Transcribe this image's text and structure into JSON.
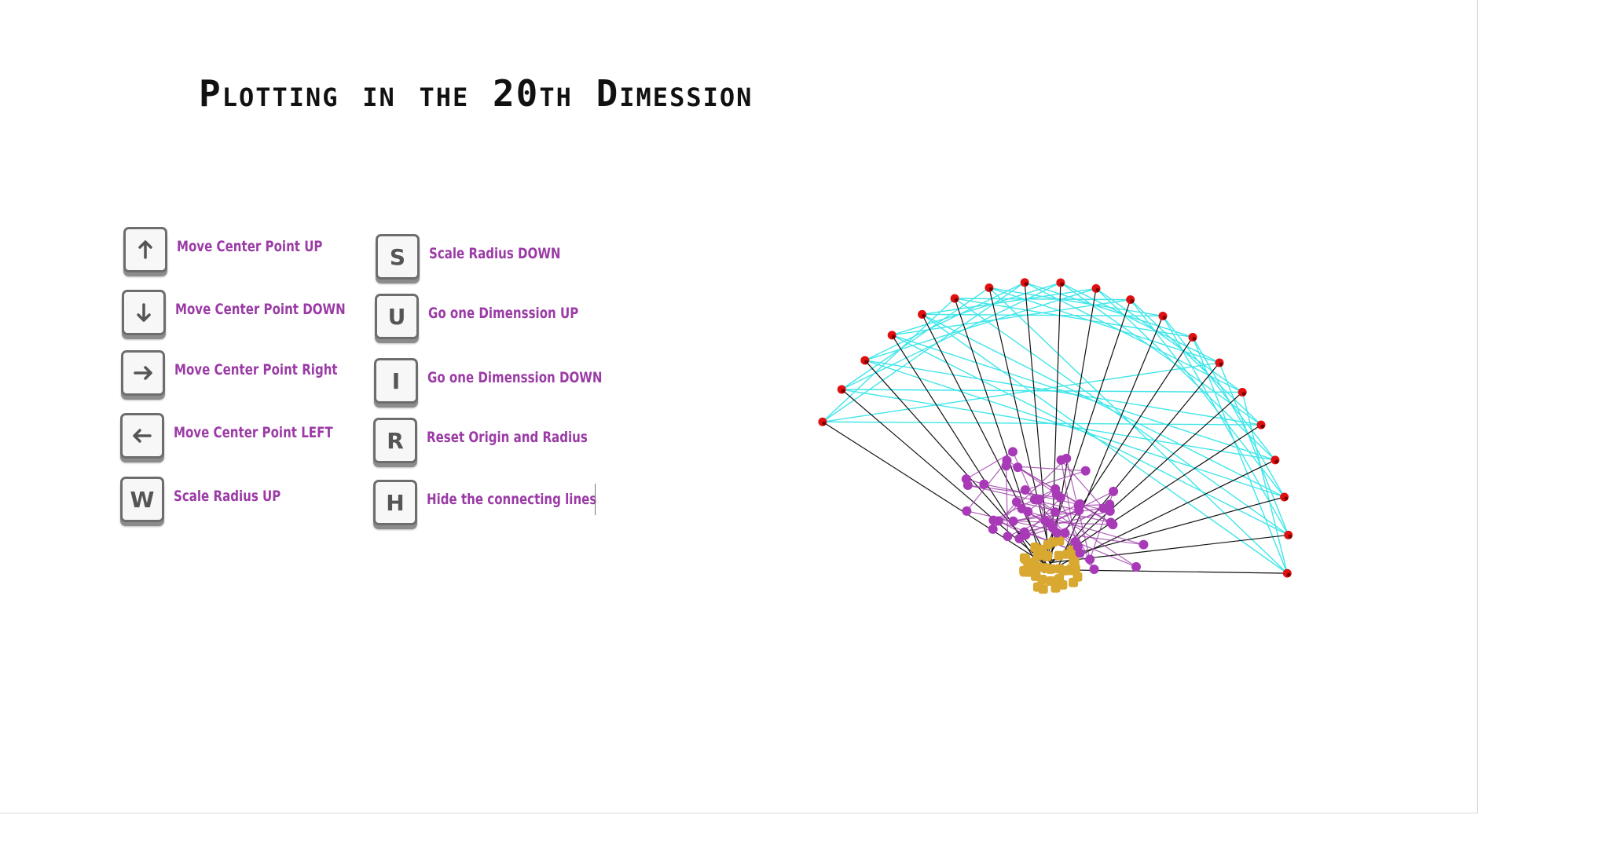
{
  "title": "Plotting in the 20th Dimession",
  "legend": {
    "left": [
      {
        "key": "↑",
        "icon": "arrow-up-icon",
        "label": "Move Center Point UP"
      },
      {
        "key": "↓",
        "icon": "arrow-down-icon",
        "label": "Move Center Point DOWN"
      },
      {
        "key": "→",
        "icon": "arrow-right-icon",
        "label": "Move Center Point Right"
      },
      {
        "key": "←",
        "icon": "arrow-left-icon",
        "label": "Move Center Point LEFT"
      },
      {
        "key": "W",
        "icon": "key-w",
        "label": "Scale Radius UP"
      }
    ],
    "right": [
      {
        "key": "S",
        "icon": "key-s",
        "label": "Scale Radius DOWN"
      },
      {
        "key": "U",
        "icon": "key-u",
        "label": "Go one Dimenssion UP"
      },
      {
        "key": "I",
        "icon": "key-i",
        "label": "Go one Dimenssion DOWN"
      },
      {
        "key": "R",
        "icon": "key-r",
        "label": "Reset Origin and Radius"
      },
      {
        "key": "H",
        "icon": "key-h",
        "label": "Hide the connecting lines"
      }
    ]
  },
  "colors": {
    "axis_points": "#e01010",
    "axis_lines": "#111111",
    "connecting_lines": "#40e6ea",
    "projected_points": "#a83ab8",
    "projected_edges": "#9b3ba6",
    "center_points": "#d9a830",
    "label": "#9b3ba6"
  },
  "plot": {
    "dimension": 20,
    "axis_count": 20,
    "projected_point_count": 50,
    "center_point_count": 45
  }
}
